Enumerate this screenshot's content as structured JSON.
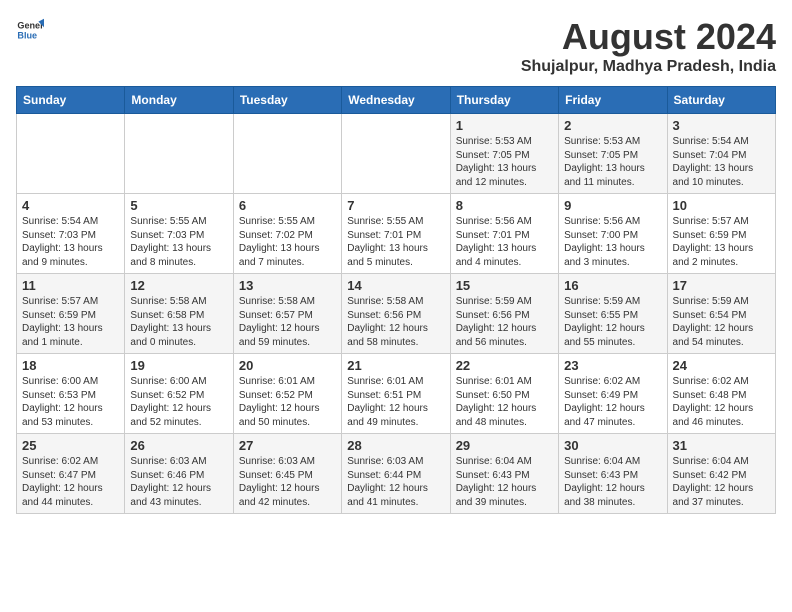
{
  "header": {
    "logo_general": "General",
    "logo_blue": "Blue",
    "title": "August 2024",
    "subtitle": "Shujalpur, Madhya Pradesh, India"
  },
  "weekdays": [
    "Sunday",
    "Monday",
    "Tuesday",
    "Wednesday",
    "Thursday",
    "Friday",
    "Saturday"
  ],
  "weeks": [
    [
      {
        "day": "",
        "info": ""
      },
      {
        "day": "",
        "info": ""
      },
      {
        "day": "",
        "info": ""
      },
      {
        "day": "",
        "info": ""
      },
      {
        "day": "1",
        "info": "Sunrise: 5:53 AM\nSunset: 7:05 PM\nDaylight: 13 hours\nand 12 minutes."
      },
      {
        "day": "2",
        "info": "Sunrise: 5:53 AM\nSunset: 7:05 PM\nDaylight: 13 hours\nand 11 minutes."
      },
      {
        "day": "3",
        "info": "Sunrise: 5:54 AM\nSunset: 7:04 PM\nDaylight: 13 hours\nand 10 minutes."
      }
    ],
    [
      {
        "day": "4",
        "info": "Sunrise: 5:54 AM\nSunset: 7:03 PM\nDaylight: 13 hours\nand 9 minutes."
      },
      {
        "day": "5",
        "info": "Sunrise: 5:55 AM\nSunset: 7:03 PM\nDaylight: 13 hours\nand 8 minutes."
      },
      {
        "day": "6",
        "info": "Sunrise: 5:55 AM\nSunset: 7:02 PM\nDaylight: 13 hours\nand 7 minutes."
      },
      {
        "day": "7",
        "info": "Sunrise: 5:55 AM\nSunset: 7:01 PM\nDaylight: 13 hours\nand 5 minutes."
      },
      {
        "day": "8",
        "info": "Sunrise: 5:56 AM\nSunset: 7:01 PM\nDaylight: 13 hours\nand 4 minutes."
      },
      {
        "day": "9",
        "info": "Sunrise: 5:56 AM\nSunset: 7:00 PM\nDaylight: 13 hours\nand 3 minutes."
      },
      {
        "day": "10",
        "info": "Sunrise: 5:57 AM\nSunset: 6:59 PM\nDaylight: 13 hours\nand 2 minutes."
      }
    ],
    [
      {
        "day": "11",
        "info": "Sunrise: 5:57 AM\nSunset: 6:59 PM\nDaylight: 13 hours\nand 1 minute."
      },
      {
        "day": "12",
        "info": "Sunrise: 5:58 AM\nSunset: 6:58 PM\nDaylight: 13 hours\nand 0 minutes."
      },
      {
        "day": "13",
        "info": "Sunrise: 5:58 AM\nSunset: 6:57 PM\nDaylight: 12 hours\nand 59 minutes."
      },
      {
        "day": "14",
        "info": "Sunrise: 5:58 AM\nSunset: 6:56 PM\nDaylight: 12 hours\nand 58 minutes."
      },
      {
        "day": "15",
        "info": "Sunrise: 5:59 AM\nSunset: 6:56 PM\nDaylight: 12 hours\nand 56 minutes."
      },
      {
        "day": "16",
        "info": "Sunrise: 5:59 AM\nSunset: 6:55 PM\nDaylight: 12 hours\nand 55 minutes."
      },
      {
        "day": "17",
        "info": "Sunrise: 5:59 AM\nSunset: 6:54 PM\nDaylight: 12 hours\nand 54 minutes."
      }
    ],
    [
      {
        "day": "18",
        "info": "Sunrise: 6:00 AM\nSunset: 6:53 PM\nDaylight: 12 hours\nand 53 minutes."
      },
      {
        "day": "19",
        "info": "Sunrise: 6:00 AM\nSunset: 6:52 PM\nDaylight: 12 hours\nand 52 minutes."
      },
      {
        "day": "20",
        "info": "Sunrise: 6:01 AM\nSunset: 6:52 PM\nDaylight: 12 hours\nand 50 minutes."
      },
      {
        "day": "21",
        "info": "Sunrise: 6:01 AM\nSunset: 6:51 PM\nDaylight: 12 hours\nand 49 minutes."
      },
      {
        "day": "22",
        "info": "Sunrise: 6:01 AM\nSunset: 6:50 PM\nDaylight: 12 hours\nand 48 minutes."
      },
      {
        "day": "23",
        "info": "Sunrise: 6:02 AM\nSunset: 6:49 PM\nDaylight: 12 hours\nand 47 minutes."
      },
      {
        "day": "24",
        "info": "Sunrise: 6:02 AM\nSunset: 6:48 PM\nDaylight: 12 hours\nand 46 minutes."
      }
    ],
    [
      {
        "day": "25",
        "info": "Sunrise: 6:02 AM\nSunset: 6:47 PM\nDaylight: 12 hours\nand 44 minutes."
      },
      {
        "day": "26",
        "info": "Sunrise: 6:03 AM\nSunset: 6:46 PM\nDaylight: 12 hours\nand 43 minutes."
      },
      {
        "day": "27",
        "info": "Sunrise: 6:03 AM\nSunset: 6:45 PM\nDaylight: 12 hours\nand 42 minutes."
      },
      {
        "day": "28",
        "info": "Sunrise: 6:03 AM\nSunset: 6:44 PM\nDaylight: 12 hours\nand 41 minutes."
      },
      {
        "day": "29",
        "info": "Sunrise: 6:04 AM\nSunset: 6:43 PM\nDaylight: 12 hours\nand 39 minutes."
      },
      {
        "day": "30",
        "info": "Sunrise: 6:04 AM\nSunset: 6:43 PM\nDaylight: 12 hours\nand 38 minutes."
      },
      {
        "day": "31",
        "info": "Sunrise: 6:04 AM\nSunset: 6:42 PM\nDaylight: 12 hours\nand 37 minutes."
      }
    ]
  ]
}
